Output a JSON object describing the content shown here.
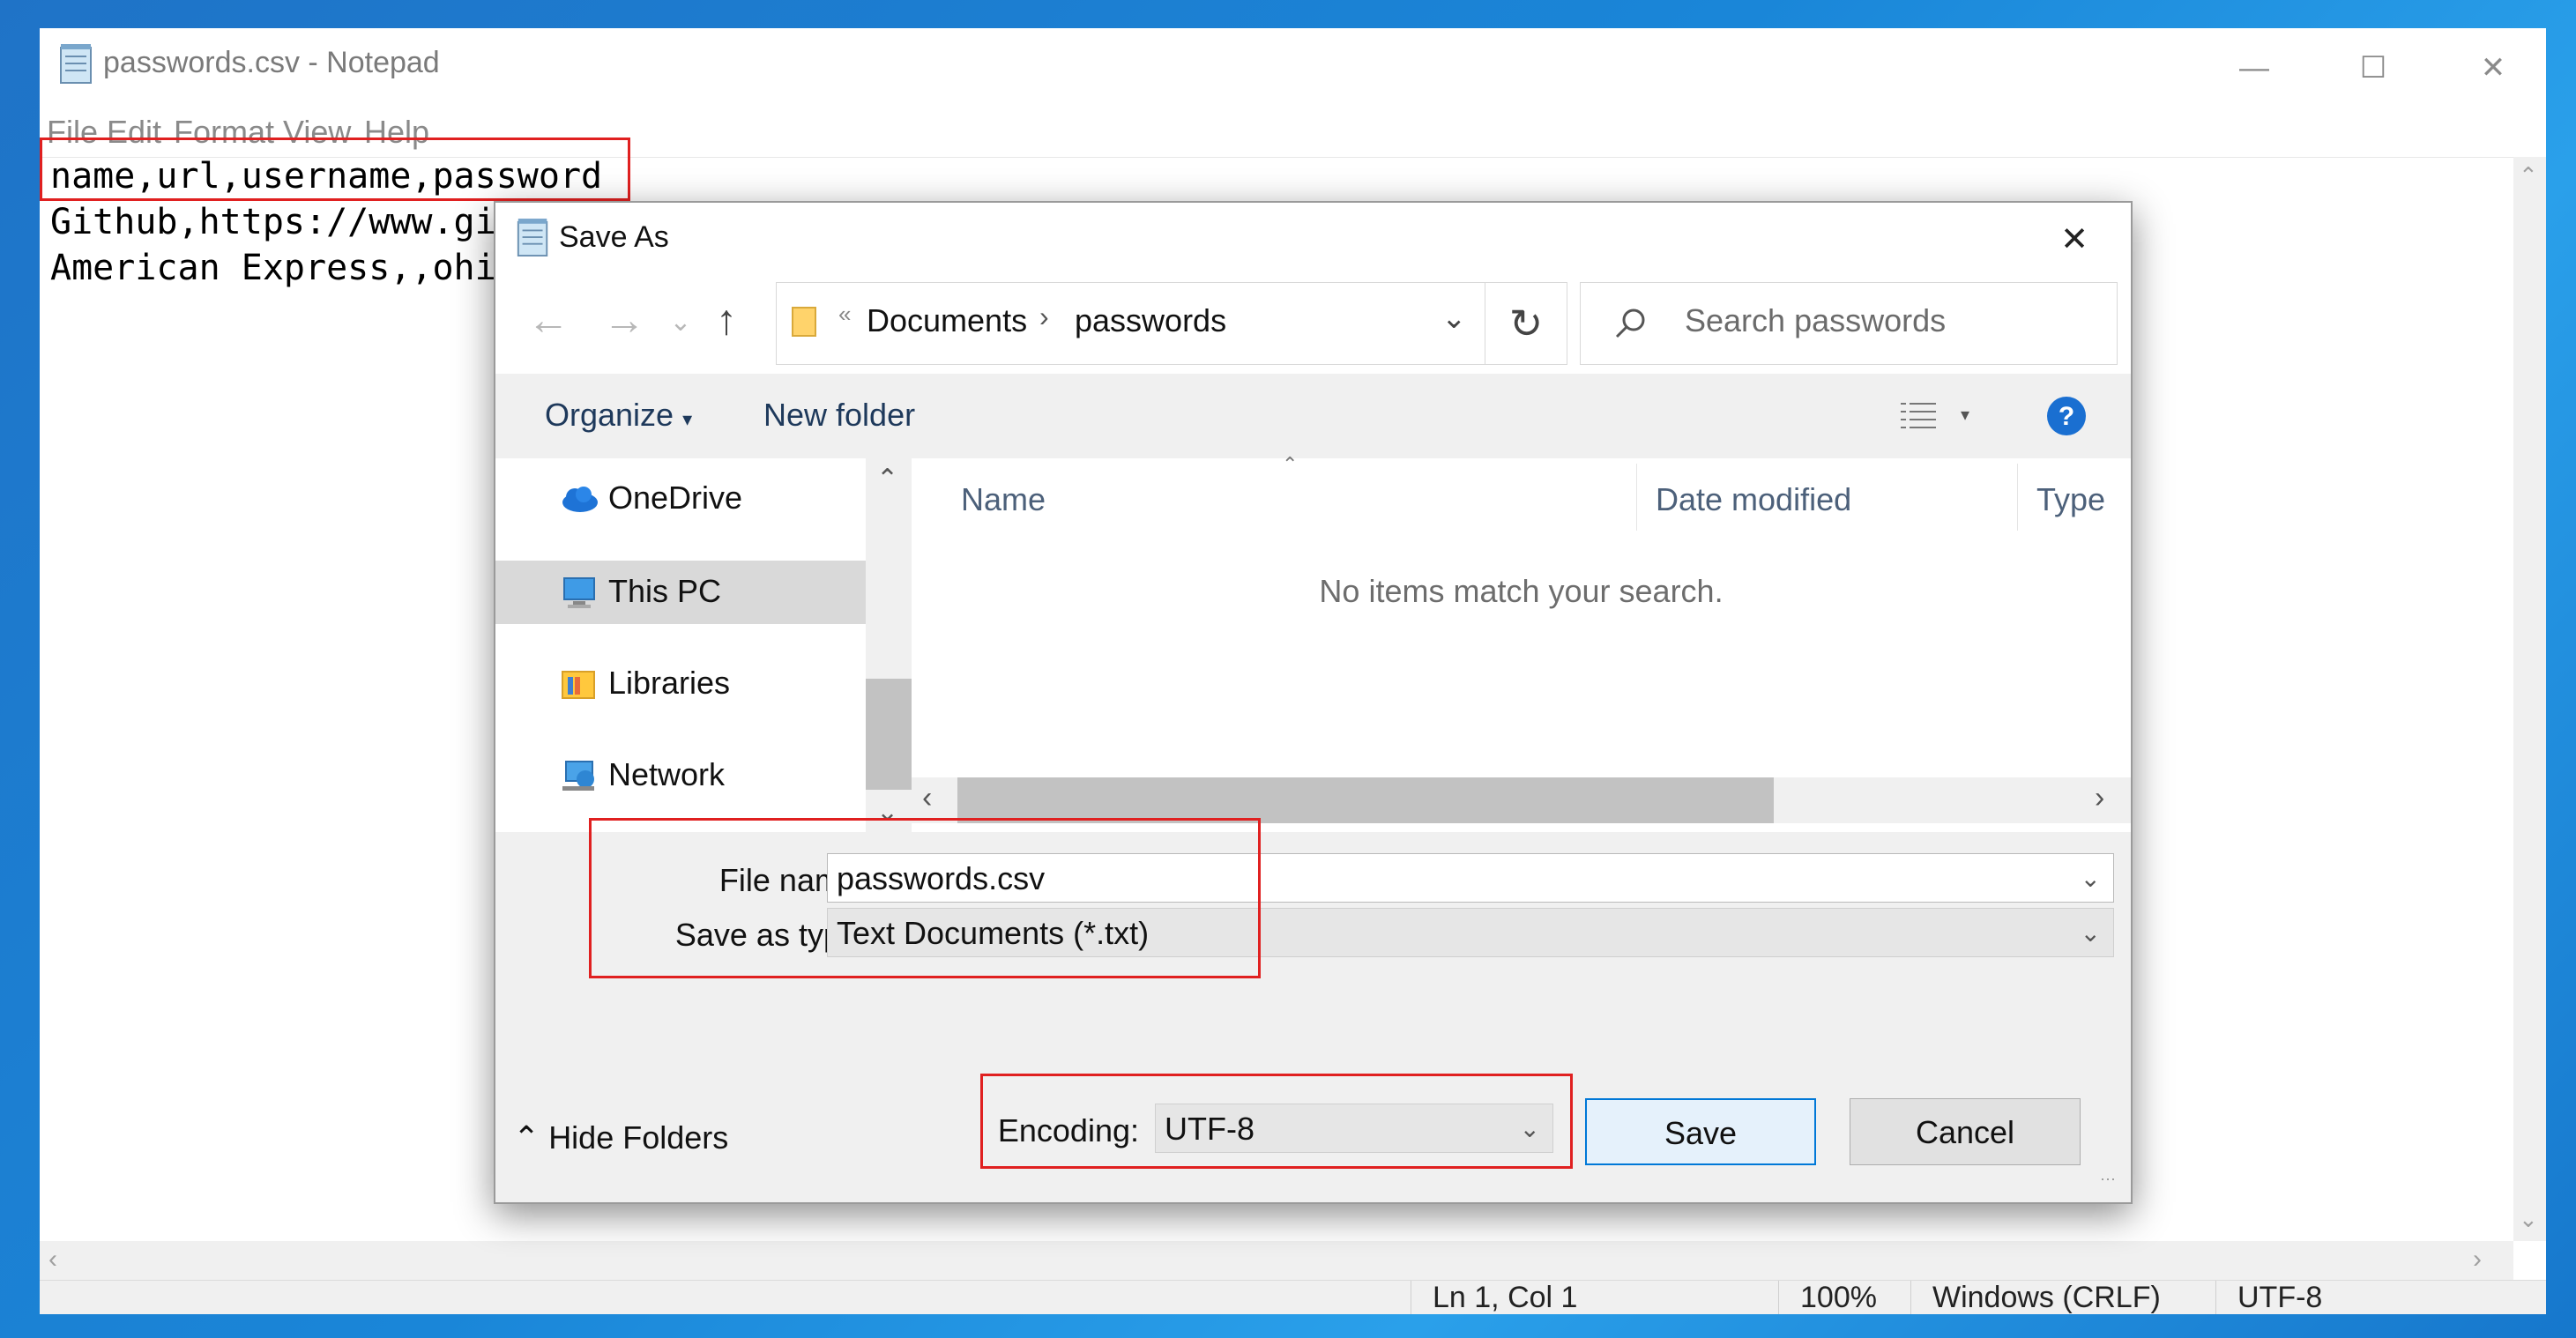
{
  "notepad": {
    "title": "passwords.csv - Notepad",
    "menu": [
      "File",
      "Edit",
      "Format",
      "View",
      "Help"
    ],
    "lines": [
      "name,url,username,password",
      "Github,https://www.gi",
      "American Express,,ohi"
    ],
    "status": {
      "position": "Ln 1, Col 1",
      "zoom": "100%",
      "line_ending": "Windows (CRLF)",
      "encoding": "UTF-8"
    }
  },
  "dialog": {
    "title": "Save As",
    "breadcrumb": [
      "Documents",
      "passwords"
    ],
    "search_placeholder": "Search passwords",
    "toolbar": {
      "organize": "Organize",
      "new_folder": "New folder"
    },
    "nav_items": [
      {
        "label": "OneDrive",
        "icon": "onedrive-icon"
      },
      {
        "label": "This PC",
        "icon": "computer-icon",
        "selected": true
      },
      {
        "label": "Libraries",
        "icon": "libraries-icon"
      },
      {
        "label": "Network",
        "icon": "network-icon"
      }
    ],
    "columns": [
      "Name",
      "Date modified",
      "Type"
    ],
    "empty_message": "No items match your search.",
    "file_name_label": "File name:",
    "file_name_value": "passwords.csv",
    "save_type_label": "Save as type:",
    "save_type_value": "Text Documents (*.txt)",
    "hide_folders": "Hide Folders",
    "encoding_label": "Encoding:",
    "encoding_value": "UTF-8",
    "save_button": "Save",
    "cancel_button": "Cancel"
  },
  "colors": {
    "highlight_box": "#e02020",
    "accent": "#0078d7"
  }
}
